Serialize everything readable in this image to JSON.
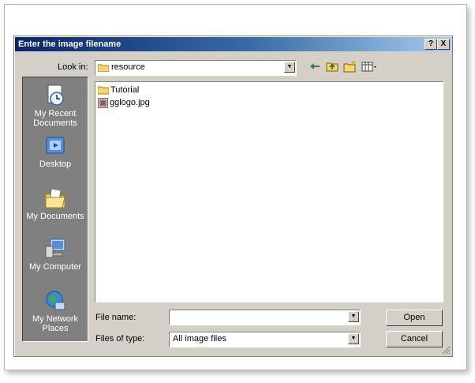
{
  "dialog": {
    "title": "Enter the image filename",
    "help_label": "?",
    "close_label": "X"
  },
  "look_in": {
    "label": "Look in:",
    "value": "resource"
  },
  "toolbar": {
    "back_icon": "back-arrow-icon",
    "up_icon": "up-folder-icon",
    "new_folder_icon": "new-folder-icon",
    "views_icon": "views-menu-icon"
  },
  "places": [
    {
      "label": "My Recent Documents",
      "icon": "recent-documents-icon"
    },
    {
      "label": "Desktop",
      "icon": "desktop-icon"
    },
    {
      "label": "My Documents",
      "icon": "my-documents-icon"
    },
    {
      "label": "My Computer",
      "icon": "my-computer-icon"
    },
    {
      "label": "My Network Places",
      "icon": "network-places-icon"
    }
  ],
  "files": [
    {
      "name": "Tutorial",
      "icon": "folder-icon"
    },
    {
      "name": "gglogo.jpg",
      "icon": "image-file-icon"
    }
  ],
  "file_name": {
    "label": "File name:",
    "value": ""
  },
  "file_type": {
    "label": "Files of type:",
    "value": "All image files"
  },
  "buttons": {
    "open": "Open",
    "cancel": "Cancel"
  }
}
